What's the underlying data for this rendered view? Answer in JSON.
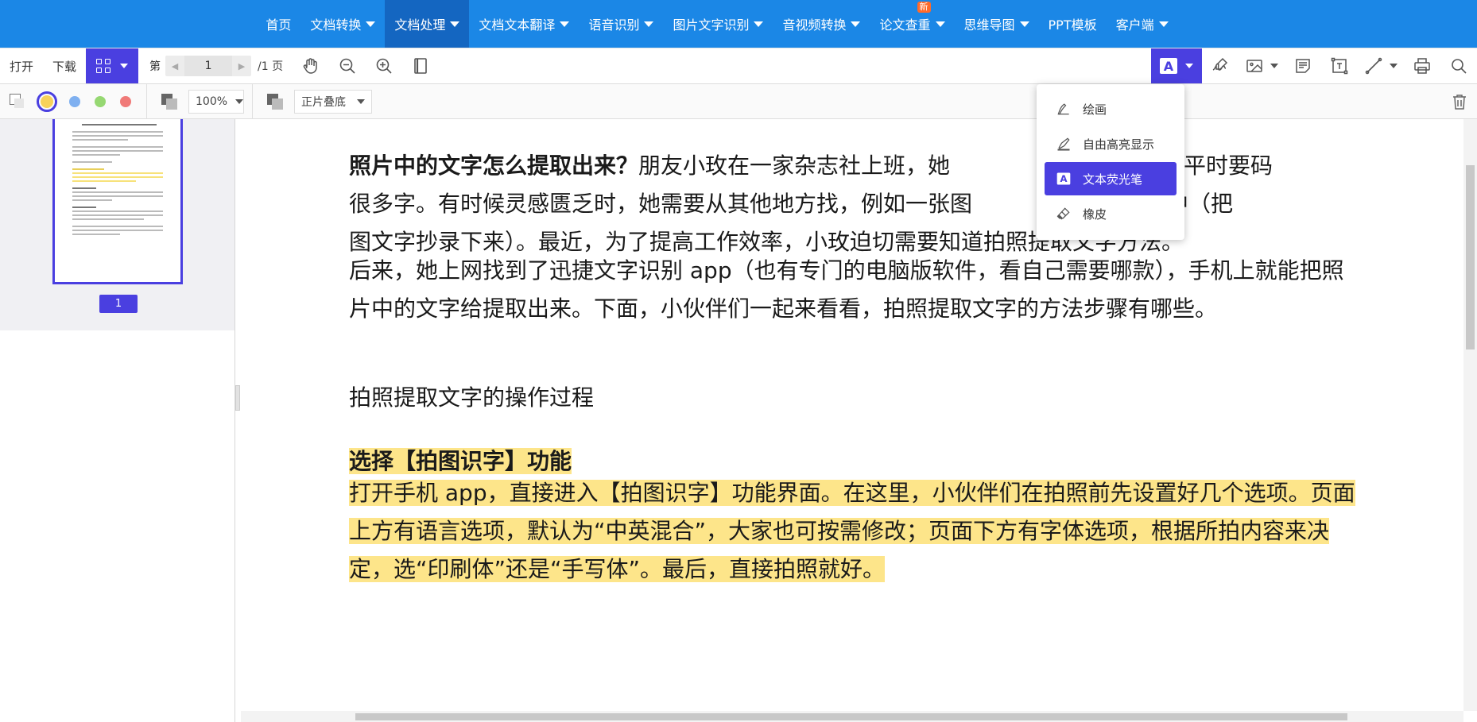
{
  "nav": {
    "items": [
      {
        "label": "首页",
        "dropdown": false,
        "active": false
      },
      {
        "label": "文档转换",
        "dropdown": true,
        "active": false
      },
      {
        "label": "文档处理",
        "dropdown": true,
        "active": true
      },
      {
        "label": "文档文本翻译",
        "dropdown": true,
        "active": false
      },
      {
        "label": "语音识别",
        "dropdown": true,
        "active": false
      },
      {
        "label": "图片文字识别",
        "dropdown": true,
        "active": false
      },
      {
        "label": "音视频转换",
        "dropdown": true,
        "active": false
      },
      {
        "label": "论文查重",
        "dropdown": true,
        "active": false,
        "badge": "新"
      },
      {
        "label": "思维导图",
        "dropdown": true,
        "active": false
      },
      {
        "label": "PPT模板",
        "dropdown": false,
        "active": false
      },
      {
        "label": "客户端",
        "dropdown": true,
        "active": false
      }
    ]
  },
  "toolbar": {
    "open_label": "打开",
    "download_label": "下载",
    "page_prefix": "第",
    "page_value": "1",
    "page_total": "/1 页",
    "icons": [
      "pan-hand-icon",
      "zoom-out-icon",
      "zoom-in-icon",
      "fit-page-icon"
    ],
    "right_icons": [
      "text-highlight-icon",
      "signature-icon",
      "image-icon",
      "note-icon",
      "textbox-icon",
      "line-icon",
      "print-icon",
      "search-icon"
    ]
  },
  "toolbar2": {
    "zoom": "100%",
    "blend_mode": "正片叠底",
    "colors": [
      "#f7d25b",
      "#7fb0f0",
      "#96d872",
      "#f07a78"
    ],
    "selected_color": "#f7d25b"
  },
  "sidebar": {
    "page_badge": "1"
  },
  "dropdown": {
    "items": [
      {
        "label": "绘画",
        "icon": "pen-draw-icon",
        "active": false
      },
      {
        "label": "自由高亮显示",
        "icon": "free-highlight-icon",
        "active": false
      },
      {
        "label": "文本荧光笔",
        "icon": "text-highlighter-icon",
        "active": true
      },
      {
        "label": "橡皮",
        "icon": "eraser-icon",
        "active": false
      }
    ]
  },
  "document": {
    "p1_bold": "照片中的文字怎么提取出来？",
    "p1_rest": "朋友小玫在一家杂志社上班，她",
    "p1_line1_tail": "作者，平时要码",
    "p1_line2": "很多字。有时候灵感匮乏时，她需要从其他地方找，例如一张图",
    "p1_line2_tail": "优美文案中（把",
    "p1_line3": "图文字抄录下来）。最近，为了提高工作效率，小玫迫切需要知道拍照提取文字方法。",
    "p2": "后来，她上网找到了迅捷文字识别 app（也有专门的电脑版软件，看自己需要哪款），手机上就能把照片中的文字给提取出来。下面，小伙伴们一起来看看，拍照提取文字的方法步骤有哪些。",
    "p3": "拍照提取文字的操作过程",
    "h1": "选择【拍图识字】功能",
    "p4": "打开手机 app，直接进入【拍图识字】功能界面。在这里，小伙伴们在拍照前先设置好几个选项。页面上方有语言选项，默认为“中英混合”，大家也可按需修改；页面下方有字体选项，根据所拍内容来决定，选“印刷体”还是“手写体”。最后，直接拍照就好。"
  }
}
